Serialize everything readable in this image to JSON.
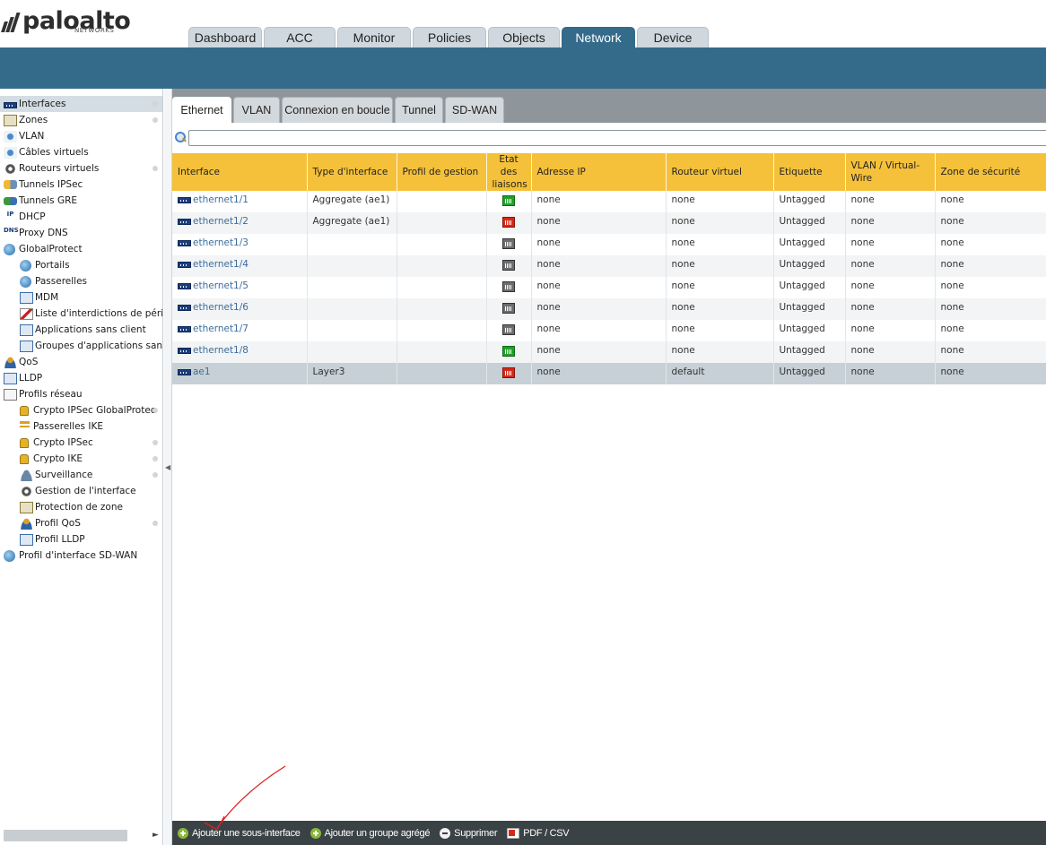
{
  "brand": {
    "name": "paloalto",
    "sub": "NETWORKS"
  },
  "main_tabs": [
    {
      "label": "Dashboard",
      "active": false
    },
    {
      "label": "ACC",
      "active": false
    },
    {
      "label": "Monitor",
      "active": false
    },
    {
      "label": "Policies",
      "active": false
    },
    {
      "label": "Objects",
      "active": false
    },
    {
      "label": "Network",
      "active": true
    },
    {
      "label": "Device",
      "active": false
    }
  ],
  "sidebar": {
    "items": [
      {
        "label": "Interfaces",
        "icon": "ethernet-port-icon",
        "level": 0,
        "selected": true,
        "dot": true
      },
      {
        "label": "Zones",
        "icon": "zones-icon",
        "level": 0,
        "dot": true
      },
      {
        "label": "VLAN",
        "icon": "vlan-icon",
        "level": 0
      },
      {
        "label": "Câbles virtuels",
        "icon": "virtual-wire-icon",
        "level": 0
      },
      {
        "label": "Routeurs virtuels",
        "icon": "router-icon",
        "level": 0,
        "dot": true
      },
      {
        "label": "Tunnels IPSec",
        "icon": "ipsec-tunnel-icon",
        "level": 0
      },
      {
        "label": "Tunnels GRE",
        "icon": "gre-tunnel-icon",
        "level": 0
      },
      {
        "label": "DHCP",
        "icon": "dhcp-icon",
        "level": 0
      },
      {
        "label": "Proxy DNS",
        "icon": "dns-icon",
        "level": 0
      },
      {
        "label": "GlobalProtect",
        "icon": "globalprotect-icon",
        "level": 0
      },
      {
        "label": "Portails",
        "icon": "portal-icon",
        "level": 1
      },
      {
        "label": "Passerelles",
        "icon": "gateway-icon",
        "level": 1
      },
      {
        "label": "MDM",
        "icon": "mdm-icon",
        "level": 1
      },
      {
        "label": "Liste d'interdictions de périphé",
        "icon": "blocklist-icon",
        "level": 1
      },
      {
        "label": "Applications sans client",
        "icon": "clientless-app-icon",
        "level": 1
      },
      {
        "label": "Groupes d'applications sans c",
        "icon": "clientless-app-group-icon",
        "level": 1
      },
      {
        "label": "QoS",
        "icon": "qos-icon",
        "level": 0
      },
      {
        "label": "LLDP",
        "icon": "lldp-icon",
        "level": 0
      },
      {
        "label": "Profils réseau",
        "icon": "network-profiles-icon",
        "level": 0
      },
      {
        "label": "Crypto IPSec GlobalProtec",
        "icon": "lock-icon",
        "level": 1,
        "dot": true
      },
      {
        "label": "Passerelles IKE",
        "icon": "ike-gateway-icon",
        "level": 1
      },
      {
        "label": "Crypto IPSec",
        "icon": "lock-icon",
        "level": 1,
        "dot": true
      },
      {
        "label": "Crypto IKE",
        "icon": "lock-icon",
        "level": 1,
        "dot": true
      },
      {
        "label": "Surveillance",
        "icon": "monitor-profile-icon",
        "level": 1,
        "dot": true
      },
      {
        "label": "Gestion de l'interface",
        "icon": "interface-mgmt-icon",
        "level": 1
      },
      {
        "label": "Protection de zone",
        "icon": "zone-protection-icon",
        "level": 1
      },
      {
        "label": "Profil QoS",
        "icon": "qos-profile-icon",
        "level": 1,
        "dot": true
      },
      {
        "label": "Profil LLDP",
        "icon": "lldp-profile-icon",
        "level": 1
      },
      {
        "label": "Profil d'interface SD-WAN",
        "icon": "sdwan-profile-icon",
        "level": 0
      }
    ]
  },
  "sub_tabs": [
    {
      "label": "Ethernet",
      "active": true
    },
    {
      "label": "VLAN",
      "active": false
    },
    {
      "label": "Connexion en boucle",
      "active": false
    },
    {
      "label": "Tunnel",
      "active": false
    },
    {
      "label": "SD-WAN",
      "active": false
    }
  ],
  "search": {
    "value": "",
    "placeholder": ""
  },
  "table": {
    "headers": [
      "Interface",
      "Type d'interface",
      "Profil de gestion",
      "Etat des liaisons",
      "Adresse IP",
      "Routeur virtuel",
      "Etiquette",
      "VLAN / Virtual-Wire",
      "Zone de sécurité"
    ],
    "rows": [
      {
        "interface": "ethernet1/1",
        "type": "Aggregate (ae1)",
        "profile": "",
        "link": "up",
        "ip": "none",
        "router": "none",
        "tag": "Untagged",
        "vlan": "none",
        "zone": "none"
      },
      {
        "interface": "ethernet1/2",
        "type": "Aggregate (ae1)",
        "profile": "",
        "link": "down",
        "ip": "none",
        "router": "none",
        "tag": "Untagged",
        "vlan": "none",
        "zone": "none"
      },
      {
        "interface": "ethernet1/3",
        "type": "",
        "profile": "",
        "link": "unknown",
        "ip": "none",
        "router": "none",
        "tag": "Untagged",
        "vlan": "none",
        "zone": "none"
      },
      {
        "interface": "ethernet1/4",
        "type": "",
        "profile": "",
        "link": "unknown",
        "ip": "none",
        "router": "none",
        "tag": "Untagged",
        "vlan": "none",
        "zone": "none"
      },
      {
        "interface": "ethernet1/5",
        "type": "",
        "profile": "",
        "link": "unknown",
        "ip": "none",
        "router": "none",
        "tag": "Untagged",
        "vlan": "none",
        "zone": "none"
      },
      {
        "interface": "ethernet1/6",
        "type": "",
        "profile": "",
        "link": "unknown",
        "ip": "none",
        "router": "none",
        "tag": "Untagged",
        "vlan": "none",
        "zone": "none"
      },
      {
        "interface": "ethernet1/7",
        "type": "",
        "profile": "",
        "link": "unknown",
        "ip": "none",
        "router": "none",
        "tag": "Untagged",
        "vlan": "none",
        "zone": "none"
      },
      {
        "interface": "ethernet1/8",
        "type": "",
        "profile": "",
        "link": "up",
        "ip": "none",
        "router": "none",
        "tag": "Untagged",
        "vlan": "none",
        "zone": "none"
      },
      {
        "interface": "ae1",
        "type": "Layer3",
        "profile": "",
        "link": "down",
        "ip": "none",
        "router": "default",
        "tag": "Untagged",
        "vlan": "none",
        "zone": "none",
        "selected": true
      }
    ]
  },
  "toolbar": {
    "add_subinterface": "Ajouter une sous-interface",
    "add_aggregate": "Ajouter un groupe agrégé",
    "delete": "Supprimer",
    "pdf_csv": "PDF / CSV"
  },
  "colors": {
    "brand_blue": "#346b8b",
    "header_yellow": "#f5c13a",
    "link_up": "#22a02a",
    "link_down": "#d42a1a",
    "link_unknown": "#6d6d6d",
    "annotation_red": "#e02020"
  }
}
